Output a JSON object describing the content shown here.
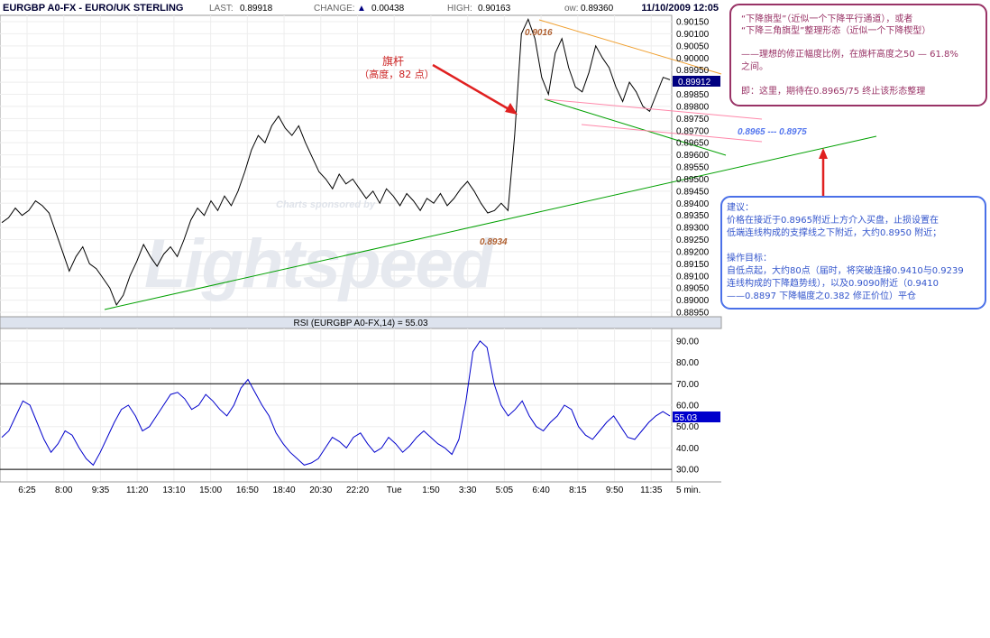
{
  "header": {
    "symbol": "EURGBP A0-FX - EURO/UK STERLING",
    "last_label": "LAST:",
    "last_value": "0.89918",
    "change_label": "CHANGE:",
    "change_arrow": "▲",
    "change_value": "0.00438",
    "high_label": "HIGH:",
    "high_value": "0.90163",
    "low_label": "ow:",
    "low_value": "0.89360",
    "datetime": "11/10/2009 12:05"
  },
  "watermark": {
    "sponsor": "Charts sponsored by",
    "brand": "Lightspeed"
  },
  "annotations": {
    "flagpole_title": "旗杆",
    "flagpole_sub": "（高度，82 点）",
    "peak_label": "0.9016",
    "low_label": "0.8934",
    "target_range": "0.8965 --- 0.8975",
    "last_price_tag": "0.89912",
    "rsi_last_tag": "55.03"
  },
  "note_top": {
    "line1": "“下降旗型”（近似一个下降平行通道），或者",
    "line2": "“下降三角旗型”整理形态（近似一个下降楔型）",
    "line3": "——理想的修正幅度比例，在旗杆高度之50 — 61.8%",
    "line4": "之间。",
    "line5": "即：这里，期待在0.8965/75 终止该形态整理"
  },
  "note_bottom": {
    "title": "建议：",
    "line1": "价格在接近于0.8965附近上方介入买盘，止损设置在",
    "line2": "低端连线构成的支撑线之下附近，大约0.8950 附近；",
    "title2": "操作目标：",
    "line3": "自低点起，大约80点（届时，将突破连接0.9410与0.9239",
    "line4": "连线构成的下降趋势线），以及0.9090附近（0.9410",
    "line5": "——0.8897 下降幅度之0.382 修正价位）平仓"
  },
  "colors": {
    "price": "#000000",
    "rsi": "#0000cc",
    "support": "#00a000",
    "upper_channel": "#f0a030",
    "pink_line": "#ff88aa",
    "red_arrow": "#e02020",
    "note_top_border": "#993366",
    "note_bottom_border": "#4a70e8"
  },
  "chart_data": [
    {
      "type": "line",
      "title": "",
      "y_axis_ticks": [
        0.9015,
        0.901,
        0.9005,
        0.9,
        0.8995,
        0.899,
        0.8985,
        0.898,
        0.8975,
        0.897,
        0.8965,
        0.896,
        0.8955,
        0.895,
        0.8945,
        0.894,
        0.8935,
        0.893,
        0.8925,
        0.892,
        0.8915,
        0.891,
        0.8905,
        0.89,
        0.8895
      ],
      "y_tick_labels": [
        "0.90150",
        "0.90100",
        "0.90050",
        "0.90000",
        "0.89950",
        "0.89900",
        "0.89850",
        "0.89800",
        "0.89750",
        "0.89700",
        "0.89650",
        "0.89600",
        "0.89550",
        "0.89500",
        "0.89450",
        "0.89400",
        "0.89350",
        "0.89300",
        "0.89250",
        "0.89200",
        "0.89150",
        "0.89100",
        "0.89050",
        "0.89000",
        "0.88950"
      ],
      "ylim": [
        0.88925,
        0.90185
      ],
      "x_tick_labels": [
        "6:25",
        "8:00",
        "9:35",
        "11:20",
        "13:10",
        "15:00",
        "16:50",
        "18:40",
        "20:30",
        "22:20",
        "Tue",
        "1:50",
        "3:30",
        "5:05",
        "6:40",
        "8:15",
        "9:50",
        "11:35"
      ],
      "x_unit": "5 min.",
      "series": [
        {
          "values": [
            0.8932,
            0.8934,
            0.8938,
            0.8935,
            0.8937,
            0.8941,
            0.8939,
            0.8936,
            0.8928,
            0.892,
            0.8912,
            0.8918,
            0.8922,
            0.8915,
            0.8913,
            0.8909,
            0.8905,
            0.8898,
            0.8902,
            0.891,
            0.8916,
            0.8923,
            0.8918,
            0.8914,
            0.8919,
            0.8922,
            0.8918,
            0.8925,
            0.8933,
            0.8938,
            0.8935,
            0.8941,
            0.8937,
            0.8943,
            0.8939,
            0.8945,
            0.8953,
            0.8962,
            0.8968,
            0.8965,
            0.8972,
            0.8976,
            0.8971,
            0.8968,
            0.8972,
            0.8965,
            0.8959,
            0.8953,
            0.895,
            0.8946,
            0.8952,
            0.8948,
            0.895,
            0.8946,
            0.8942,
            0.8945,
            0.894,
            0.8946,
            0.8943,
            0.8939,
            0.8944,
            0.8941,
            0.8937,
            0.8942,
            0.894,
            0.8944,
            0.8939,
            0.8942,
            0.8946,
            0.8949,
            0.8945,
            0.894,
            0.8936,
            0.8937,
            0.894,
            0.8937,
            0.8968,
            0.901,
            0.9016,
            0.9008,
            0.8992,
            0.8985,
            0.9002,
            0.9008,
            0.8996,
            0.8988,
            0.8986,
            0.8994,
            0.9005,
            0.9,
            0.8996,
            0.8988,
            0.8982,
            0.899,
            0.8986,
            0.898,
            0.8978,
            0.8985,
            0.8992,
            0.8991
          ]
        }
      ],
      "annotations": [
        "0.9016",
        "0.8934",
        "0.8965 --- 0.8975"
      ]
    },
    {
      "type": "line",
      "title": "RSI (EURGBP A0-FX,14) = 55.03",
      "y_tick_labels": [
        "90.00",
        "80.00",
        "70.00",
        "60.00",
        "50.00",
        "40.00",
        "30.00"
      ],
      "ylim": [
        25,
        95
      ],
      "reference_lines": [
        70,
        30
      ],
      "series": [
        {
          "values": [
            45,
            48,
            55,
            62,
            60,
            52,
            44,
            38,
            42,
            48,
            46,
            40,
            35,
            32,
            38,
            45,
            52,
            58,
            60,
            55,
            48,
            50,
            55,
            60,
            65,
            66,
            63,
            58,
            60,
            65,
            62,
            58,
            55,
            60,
            68,
            72,
            66,
            60,
            55,
            47,
            42,
            38,
            35,
            32,
            33,
            35,
            40,
            45,
            43,
            40,
            45,
            47,
            42,
            38,
            40,
            45,
            42,
            38,
            41,
            45,
            48,
            45,
            42,
            40,
            37,
            44,
            62,
            85,
            90,
            87,
            70,
            60,
            55,
            58,
            62,
            55,
            50,
            48,
            52,
            55,
            60,
            58,
            50,
            46,
            44,
            48,
            52,
            55,
            50,
            45,
            44,
            48,
            52,
            55,
            57,
            55
          ]
        }
      ]
    }
  ]
}
